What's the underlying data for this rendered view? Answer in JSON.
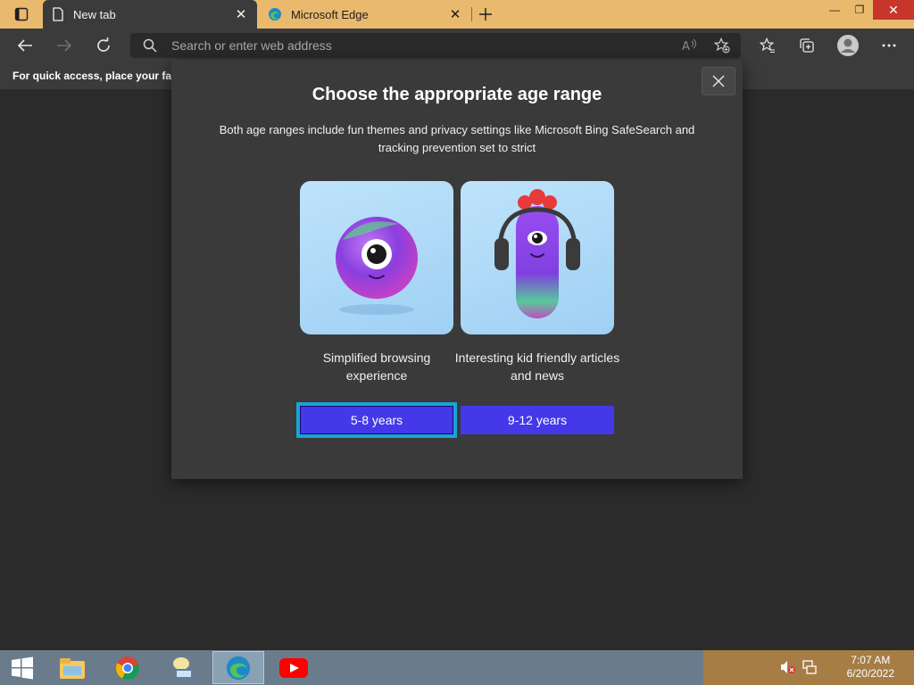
{
  "browser": {
    "tabs": [
      {
        "title": "New tab",
        "active": true,
        "icon": "page-icon"
      },
      {
        "title": "Microsoft Edge",
        "active": false,
        "icon": "edge-icon"
      }
    ],
    "address_placeholder": "Search or enter web address",
    "favorites_hint": "For quick access, place your favo"
  },
  "dialog": {
    "title": "Choose the appropriate age range",
    "description": "Both age ranges include fun themes and privacy settings like Microsoft Bing SafeSearch and tracking prevention set to strict",
    "options": [
      {
        "caption": "Simplified browsing experience",
        "button": "5-8 years",
        "selected": true
      },
      {
        "caption": "Interesting kid friendly articles and news",
        "button": "9-12 years",
        "selected": false
      }
    ]
  },
  "taskbar": {
    "apps": [
      "file-explorer-icon",
      "chrome-icon",
      "network-icon",
      "edge-icon",
      "youtube-icon"
    ],
    "time": "7:07 AM",
    "date": "6/20/2022"
  },
  "colors": {
    "titlebar": "#e9b96e",
    "button": "#4438e8",
    "focus": "#1aa3d6",
    "dialog": "#3a3a3a"
  }
}
